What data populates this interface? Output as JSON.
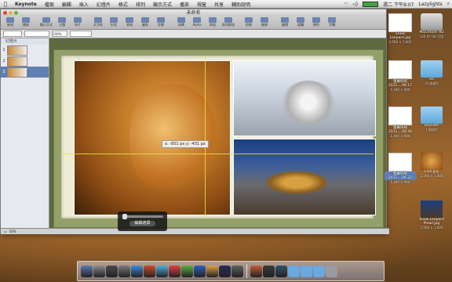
{
  "menubar": {
    "apple": "",
    "app": "Keynote",
    "items": [
      "檔案",
      "編輯",
      "插入",
      "幻燈片",
      "格式",
      "排列",
      "顯示方式",
      "播放",
      "視窗",
      "共享",
      "輔助說明"
    ],
    "clock": "週二 下午9:07",
    "user": "Lazylights",
    "search": "⌕"
  },
  "window": {
    "title": "未命名",
    "toolbar": [
      {
        "label": "新增"
      },
      {
        "label": "播放"
      },
      {
        "label": "顯示方式"
      },
      {
        "label": "主題"
      },
      {
        "label": "母片"
      },
      {
        "label": "文字框"
      },
      {
        "label": "形狀"
      },
      {
        "label": "表格"
      },
      {
        "label": "圖表"
      },
      {
        "label": "註解"
      },
      {
        "label": "遮罩"
      },
      {
        "label": "Alpha"
      },
      {
        "label": "群組"
      },
      {
        "label": "取消群組"
      },
      {
        "label": "前移"
      },
      {
        "label": "後移"
      },
      {
        "label": "檢閱"
      },
      {
        "label": "媒體"
      },
      {
        "label": "顏色"
      },
      {
        "label": "字體"
      }
    ],
    "format_zoom": "100%",
    "sidebar_header": "幻燈片",
    "slides": [
      {
        "num": "1"
      },
      {
        "num": "2"
      },
      {
        "num": "3"
      }
    ],
    "selected_slide": 3,
    "coord_readout": "x: -851 px  y: -431 px",
    "status_zoom": "50%"
  },
  "hud": {
    "button": "編輯遮罩",
    "level": 0.0
  },
  "desktop_icons": [
    {
      "name": "Snow Leopard.jpg",
      "sub": "2,560 × 1,600",
      "kind": "shot"
    },
    {
      "name": "Macintosh HD",
      "sub": "120.47 GB 可用",
      "kind": "hd"
    },
    {
      "name": "螢幕快照 2011....06.17",
      "sub": "1,440 × 900",
      "kind": "shot"
    },
    {
      "name": "ed",
      "sub": "15 個項目",
      "kind": "folder"
    },
    {
      "name": "螢幕快照 2011....04.30",
      "sub": "1,440 × 900",
      "kind": "shot"
    },
    {
      "name": "keynote",
      "sub": "1 個項目",
      "kind": "folder"
    },
    {
      "name": "螢幕快照 2011....06.22",
      "sub": "1,440 × 900",
      "kind": "shot",
      "selected": true
    },
    {
      "name": "Lion.jpg",
      "sub": "2,560 × 1,600",
      "kind": "lionpic"
    },
    {
      "name": "Snow Leopard Prowl.jpg",
      "sub": "2,560 × 1,600",
      "kind": "snowpic"
    }
  ],
  "colors": {
    "menubar": "#e8e8e8",
    "selection": "#5f7fb5",
    "guide": "#e7e24a",
    "slide_bg": "#93a06a",
    "paper": "#efecd6"
  }
}
